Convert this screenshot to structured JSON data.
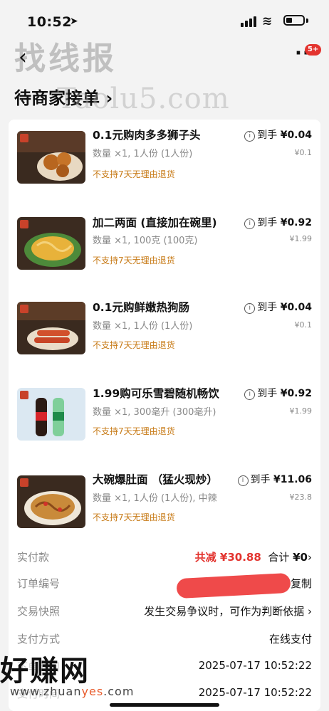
{
  "status": {
    "time": "10:52"
  },
  "nav": {
    "badge": "5+"
  },
  "watermarks": {
    "top": "找线报",
    "mid": "Taolu5.com",
    "bottom": "好赚网",
    "bottom_url_pre": "www.zhuan",
    "bottom_url_mid": "yes",
    "bottom_url_post": ".com"
  },
  "page": {
    "title": "待商家接单 ›"
  },
  "items": [
    {
      "name": "0.1元购肉多多狮子头",
      "qty": "数量 ×1, 1人份 (1人份)",
      "note": "不支持7天无理由退货",
      "price_label": "到手",
      "price": "¥0.04",
      "original": "¥0.1"
    },
    {
      "name": "加二两面 (直接加在碗里)",
      "qty": "数量 ×1, 100克 (100克)",
      "note": "不支持7天无理由退货",
      "price_label": "到手",
      "price": "¥0.92",
      "original": "¥1.99"
    },
    {
      "name": "0.1元购鲜嫩热狗肠",
      "qty": "数量 ×1, 1人份 (1人份)",
      "note": "不支持7天无理由退货",
      "price_label": "到手",
      "price": "¥0.04",
      "original": "¥0.1"
    },
    {
      "name": "1.99购可乐雪碧随机畅饮",
      "qty": "数量 ×1, 300毫升 (300毫升)",
      "note": "不支持7天无理由退货",
      "price_label": "到手",
      "price": "¥0.92",
      "original": "¥1.99"
    },
    {
      "name": "大碗爆肚面 （猛火现炒）",
      "qty": "数量 ×1, 1人份 (1人份), 中辣",
      "note": "不支持7天无理由退货",
      "price_label": "到手",
      "price": "¥11.06",
      "original": "¥23.8"
    }
  ],
  "details": {
    "paid": {
      "label": "实付款",
      "discount": "共减 ¥30.88",
      "total_label": "合计",
      "total": "¥0",
      "chevron": "›"
    },
    "order_no": {
      "label": "订单编号",
      "copy": "复制"
    },
    "snapshot": {
      "label": "交易快照",
      "value": "发生交易争议时，可作为判断依据 ›"
    },
    "payment": {
      "label": "支付方式",
      "value": "在线支付"
    },
    "order_time": {
      "label": "下单时间",
      "value": "2025-07-17 10:52:22"
    },
    "pay_time": {
      "label": "支付时间",
      "value": "2025-07-17 10:52:22"
    }
  }
}
